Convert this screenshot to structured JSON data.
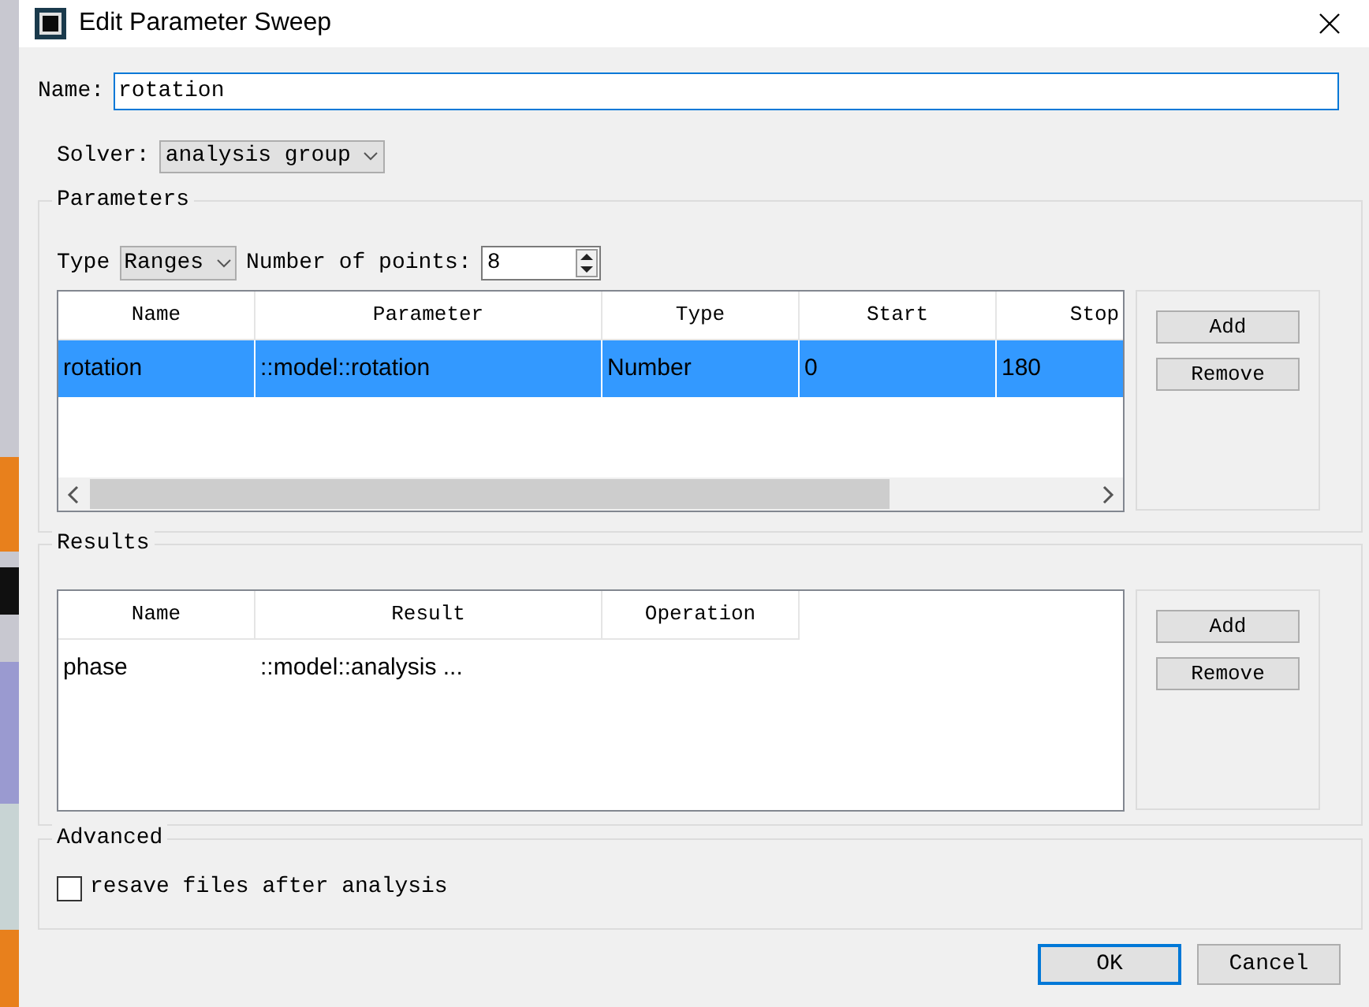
{
  "window": {
    "title": "Edit Parameter Sweep"
  },
  "name_field": {
    "label": "Name:",
    "value": "rotation"
  },
  "solver": {
    "label": "Solver:",
    "value": "analysis group"
  },
  "parameters": {
    "title": "Parameters",
    "type_label": "Type",
    "type_value": "Ranges",
    "points_label": "Number of points:",
    "points_value": "8",
    "table": {
      "columns": [
        "Name",
        "Parameter",
        "Type",
        "Start",
        "Stop"
      ],
      "rows": [
        {
          "cells": [
            "rotation",
            "::model::rotation",
            "Number",
            "0",
            "180"
          ],
          "selected": true
        }
      ]
    },
    "buttons": [
      "Add",
      "Remove"
    ]
  },
  "results": {
    "title": "Results",
    "table": {
      "columns": [
        "Name",
        "Result",
        "Operation"
      ],
      "rows": [
        {
          "cells": [
            "phase",
            "::model::analysis ..."
          ],
          "selected": false
        }
      ]
    },
    "buttons": [
      "Add",
      "Remove"
    ]
  },
  "advanced": {
    "title": "Advanced",
    "checkbox": {
      "label": "resave files after analysis",
      "checked": false
    }
  },
  "buttons": [
    {
      "label": "OK",
      "default": true
    },
    {
      "label": "Cancel",
      "default": false
    }
  ]
}
